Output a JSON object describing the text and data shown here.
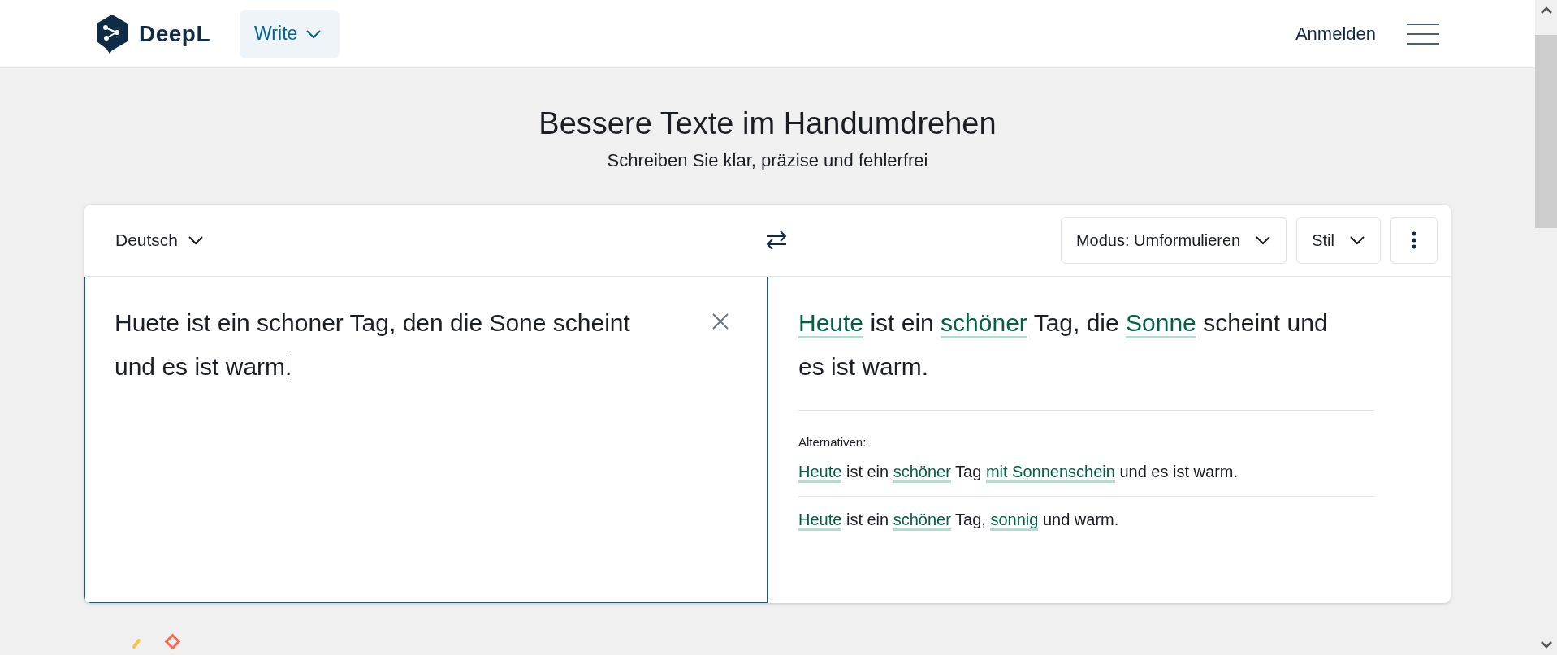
{
  "header": {
    "logo_text": "DeepL",
    "product_menu": {
      "label": "Write"
    },
    "login": "Anmelden"
  },
  "hero": {
    "title": "Bessere Texte im Handumdrehen",
    "subtitle": "Schreiben Sie klar, präzise und fehlerfrei"
  },
  "toolbar": {
    "language": "Deutsch",
    "mode": "Modus: Umformulieren",
    "style": "Stil"
  },
  "input": {
    "value": "Huete ist ein schoner Tag, den die Sone scheint und es ist warm."
  },
  "output": {
    "segments": [
      {
        "text": "Heute",
        "changed": true
      },
      {
        "text": " ist ein ",
        "changed": false
      },
      {
        "text": "schöner",
        "changed": true
      },
      {
        "text": " Tag, die ",
        "changed": false
      },
      {
        "text": "Sonne",
        "changed": true
      },
      {
        "text": " scheint und es ist warm.",
        "changed": false
      }
    ]
  },
  "alternatives": {
    "label": "Alternativen:",
    "items": [
      {
        "segments": [
          {
            "text": "Heute",
            "changed": true
          },
          {
            "text": " ist ein ",
            "changed": false
          },
          {
            "text": "schöner",
            "changed": true
          },
          {
            "text": " Tag ",
            "changed": false
          },
          {
            "text": "mit Sonnenschein",
            "changed": true
          },
          {
            "text": " und es ist warm.",
            "changed": false
          }
        ]
      },
      {
        "segments": [
          {
            "text": "Heute",
            "changed": true
          },
          {
            "text": " ist ein ",
            "changed": false
          },
          {
            "text": "schöner",
            "changed": true
          },
          {
            "text": " Tag, ",
            "changed": false
          },
          {
            "text": "sonnig",
            "changed": true
          },
          {
            "text": " und warm.",
            "changed": false
          }
        ]
      }
    ]
  }
}
